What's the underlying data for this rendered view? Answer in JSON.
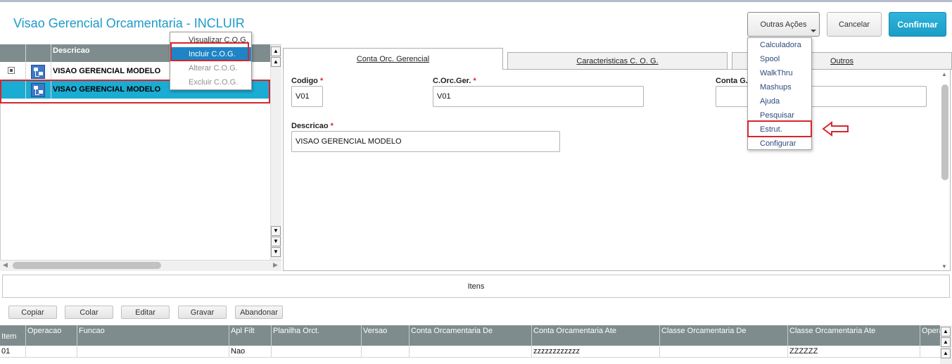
{
  "page": {
    "title": "Visao Gerencial Orcamentaria - INCLUIR"
  },
  "toolbar": {
    "outras_label": "Outras Ações",
    "cancel_label": "Cancelar",
    "confirm_label": "Confirmar"
  },
  "outras_menu": {
    "items": [
      "Calculadora",
      "Spool",
      "WalkThru",
      "Mashups",
      "Ajuda",
      "Pesquisar",
      "Estrut.",
      "Configurar"
    ],
    "highlighted": "Estrut."
  },
  "tree": {
    "header": "Descricao",
    "rows": [
      {
        "label": "VISAO GERENCIAL MODELO",
        "selected": false
      },
      {
        "label": "VISAO GERENCIAL MODELO",
        "selected": true
      }
    ]
  },
  "context_menu": {
    "items": [
      {
        "label": "Visualizar C.O.G.",
        "state": "normal"
      },
      {
        "label": "Incluir C.O.G.",
        "state": "selected"
      },
      {
        "label": "Alterar C.O.G.",
        "state": "disabled"
      },
      {
        "label": "Excluir C.O.G.",
        "state": "disabled"
      }
    ]
  },
  "tabs": [
    {
      "label": "Conta Orc. Gerencial",
      "active": true
    },
    {
      "label": "Caracteristicas C. O. G.",
      "active": false
    },
    {
      "label": "Outros",
      "active": false
    }
  ],
  "form": {
    "codigo": {
      "label": "Codigo",
      "value": "V01"
    },
    "corcger": {
      "label": "C.Orc.Ger.",
      "value": "V01"
    },
    "contag": {
      "label": "Conta G.",
      "value": ""
    },
    "descricao": {
      "label": "Descricao",
      "value": "VISAO GERENCIAL MODELO"
    },
    "required_mark": "*"
  },
  "itens": {
    "title": "Itens",
    "buttons": [
      "Copiar",
      "Colar",
      "Editar",
      "Gravar",
      "Abandonar"
    ],
    "columns": [
      "Item",
      "Operacao",
      "Funcao",
      "Apl Filt",
      "Planilha Orct.",
      "Versao",
      "Conta Orcamentaria De",
      "Conta Orcamentaria Ate",
      "Classe Orcamentaria De",
      "Classe Orcamentaria Ate",
      "Opera"
    ],
    "rows": [
      [
        "01",
        "",
        "",
        "Nao",
        "",
        "",
        "",
        "zzzzzzzzzzzz",
        "",
        "ZZZZZZ",
        ""
      ]
    ]
  },
  "colors": {
    "accent": "#1e9ac8",
    "highlight": "#d6262d",
    "selection": "#1bacd3"
  }
}
